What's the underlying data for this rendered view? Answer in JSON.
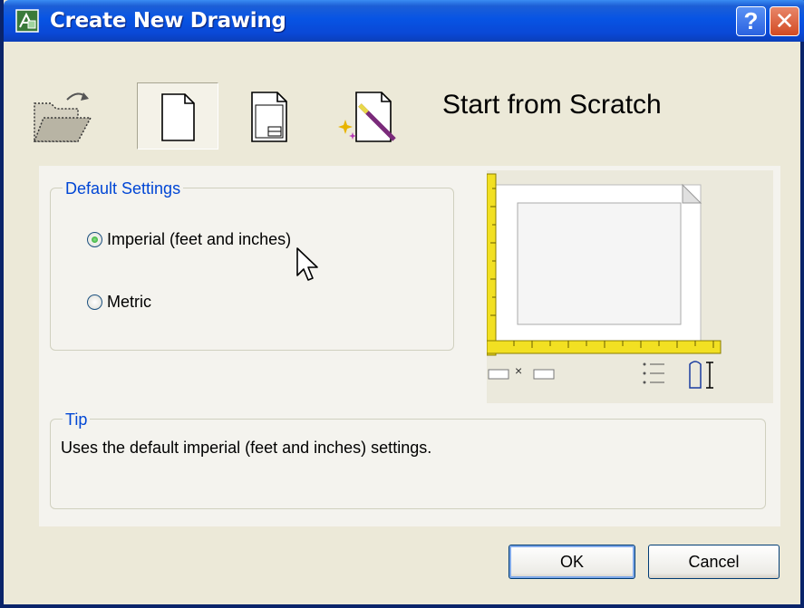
{
  "window": {
    "title": "Create New Drawing",
    "icon": "autocad-app-icon",
    "help_label": "?",
    "close_label": "✕"
  },
  "toolbar": {
    "items": [
      {
        "name": "open-drawing",
        "icon": "folder-open-icon"
      },
      {
        "name": "start-from-scratch",
        "icon": "blank-page-icon",
        "selected": true
      },
      {
        "name": "use-template",
        "icon": "template-page-icon"
      },
      {
        "name": "use-wizard",
        "icon": "wizard-wand-icon"
      }
    ]
  },
  "heading": "Start from Scratch",
  "default_settings": {
    "legend": "Default Settings",
    "options": [
      {
        "label": "Imperial (feet and inches)",
        "checked": true
      },
      {
        "label": "Metric",
        "checked": false
      }
    ]
  },
  "preview": {
    "size_label": "×"
  },
  "tip": {
    "legend": "Tip",
    "text": "Uses the default imperial (feet and inches) settings."
  },
  "buttons": {
    "ok": "OK",
    "cancel": "Cancel"
  },
  "colors": {
    "title_bar": "#0754e4",
    "group_legend": "#0046d5",
    "ruler": "#f2e022"
  }
}
